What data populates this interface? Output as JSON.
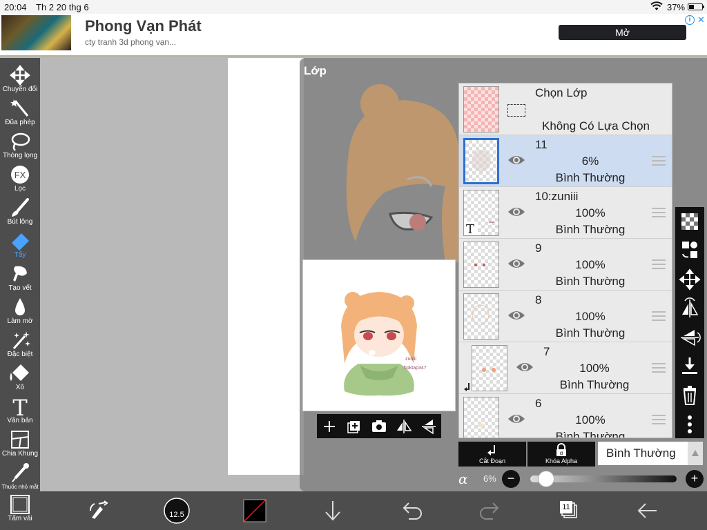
{
  "status_bar": {
    "time": "20:04",
    "date": "Th 2 20 thg 6",
    "battery": "37%"
  },
  "ad": {
    "title": "Phong Vạn Phát",
    "subtitle": "cty tranh 3d phong vạn...",
    "open_button": "Mở"
  },
  "toolbar": {
    "active_color": "#4aa3ff",
    "tools": [
      {
        "label": "Chuyển đổi",
        "icon": "move-icon"
      },
      {
        "label": "Đũa phép",
        "icon": "magic-wand-icon"
      },
      {
        "label": "Thòng lọng",
        "icon": "lasso-icon"
      },
      {
        "label": "Lọc",
        "icon": "fx-icon"
      },
      {
        "label": "Bút lông",
        "icon": "brush-icon"
      },
      {
        "label": "Tẩy",
        "icon": "eraser-icon",
        "active": true
      },
      {
        "label": "Tạo vết",
        "icon": "smudge-icon"
      },
      {
        "label": "Làm mờ",
        "icon": "blur-icon"
      },
      {
        "label": "Đặc biệt",
        "icon": "special-icon"
      },
      {
        "label": "Xô",
        "icon": "bucket-icon"
      },
      {
        "label": "Văn bản",
        "icon": "text-icon"
      },
      {
        "label": "Chia Khung",
        "icon": "frame-divider-icon"
      },
      {
        "label": "Thuốc nhỏ mắt",
        "icon": "eyedropper-icon"
      },
      {
        "label": "Tấm vải",
        "icon": "canvas-icon"
      }
    ]
  },
  "layer_panel": {
    "title": "Lớp",
    "preview_signature": [
      "zuniii",
      "hoktap347"
    ],
    "select_layer": {
      "title": "Chọn Lớp",
      "status": "Không Có Lựa Chọn"
    },
    "layers": [
      {
        "name": "11",
        "opacity": "6%",
        "mode": "Bình Thường",
        "selected": true
      },
      {
        "name": "10:zuniii",
        "opacity": "100%",
        "mode": "Bình Thường",
        "text_layer": true,
        "text_layer_glyph": "T"
      },
      {
        "name": "9",
        "opacity": "100%",
        "mode": "Bình Thường"
      },
      {
        "name": "8",
        "opacity": "100%",
        "mode": "Bình Thường"
      },
      {
        "name": "7",
        "opacity": "100%",
        "mode": "Bình Thường",
        "clipped": true
      },
      {
        "name": "6",
        "opacity": "100%",
        "mode": "Bình Thường"
      }
    ],
    "clipping_label": "Cắt Đoạn",
    "alpha_lock_label": "Khóa Alpha",
    "blend_mode": "Bình Thường",
    "opacity_symbol": "α",
    "opacity_value": "6%",
    "opacity_fraction": 0.06,
    "minus_label": "−",
    "plus_label": "+"
  },
  "bottom_bar": {
    "brush_size": "12.5",
    "layer_count": "11",
    "color_swatch": "#000000"
  }
}
